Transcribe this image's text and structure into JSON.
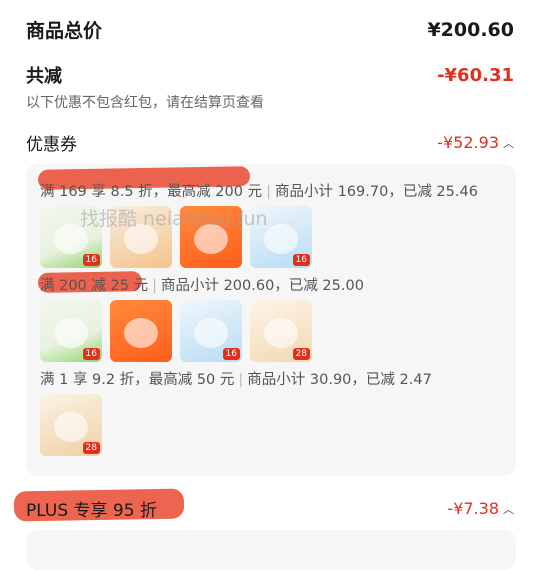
{
  "summary": {
    "total_label": "商品总价",
    "total_value": "¥200.60",
    "reduce_label": "共减",
    "reduce_value": "-¥60.31",
    "note": "以下优惠不包含红包，请在结算页查看"
  },
  "coupon": {
    "label": "优惠券",
    "amount": "-¥52.93",
    "tiers": [
      {
        "rule": "满 169 享 8.5 折，最高减 200 元",
        "subtotal": "商品小计 169.70，已减 25.46",
        "thumb_tags": [
          "16",
          "",
          "",
          "16"
        ]
      },
      {
        "rule": "满 200 减 25 元",
        "subtotal": "商品小计 200.60，已减 25.00",
        "thumb_tags": [
          "16",
          "",
          "16",
          "28"
        ]
      },
      {
        "rule": "满 1 享 9.2 折，最高减 50 元",
        "subtotal": "商品小计 30.90，已减 2.47",
        "thumb_tags": [
          "28"
        ]
      }
    ]
  },
  "plus": {
    "label": "PLUS 专享 95 折",
    "amount": "-¥7.38"
  },
  "watermark": "找报酷 neianbao.fun",
  "colors": {
    "accent": "#e0301e",
    "card_bg": "#f6f6f6"
  }
}
